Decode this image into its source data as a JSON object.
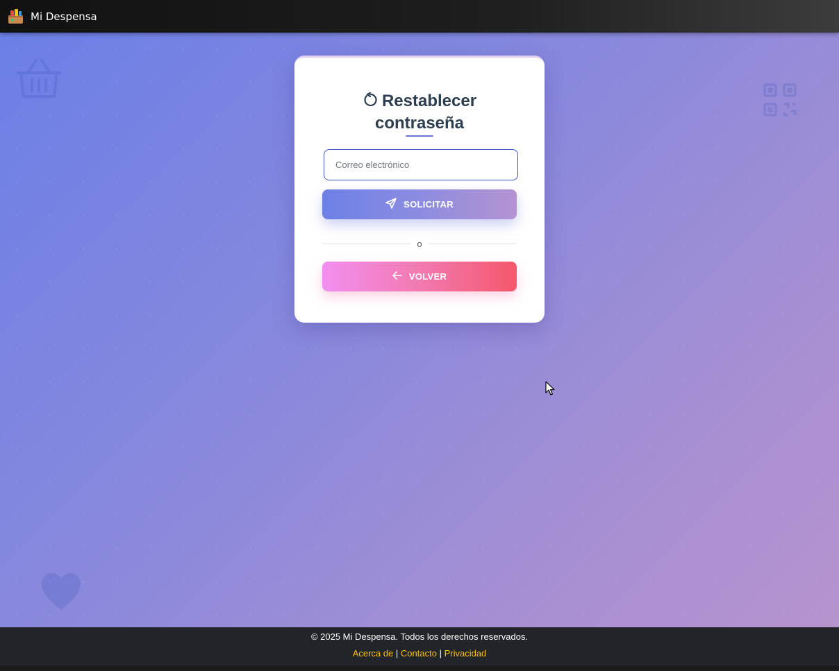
{
  "app": {
    "brand": "Mi Despensa"
  },
  "reset_form": {
    "title_line1": "Restablecer",
    "title_line2": "contraseña",
    "email_placeholder": "Correo electrónico",
    "submit_label": "SOLICITAR",
    "divider_label": "o",
    "back_label": "VOLVER"
  },
  "footer": {
    "copyright": "© 2025 Mi Despensa. Todos los derechos reservados.",
    "links": [
      "Acerca de",
      "Contacto",
      "Privacidad"
    ],
    "separator": "|"
  },
  "colors": {
    "accent_gradient_start": "#667eea",
    "accent_gradient_end": "#b793cf",
    "back_gradient_start": "#f093fb",
    "back_gradient_end": "#f5576c",
    "footer_link": "#ffc107"
  },
  "icons": [
    "basket-icon",
    "qr-code-icon",
    "heart-icon",
    "refresh-icon",
    "send-icon",
    "arrow-left-icon"
  ]
}
